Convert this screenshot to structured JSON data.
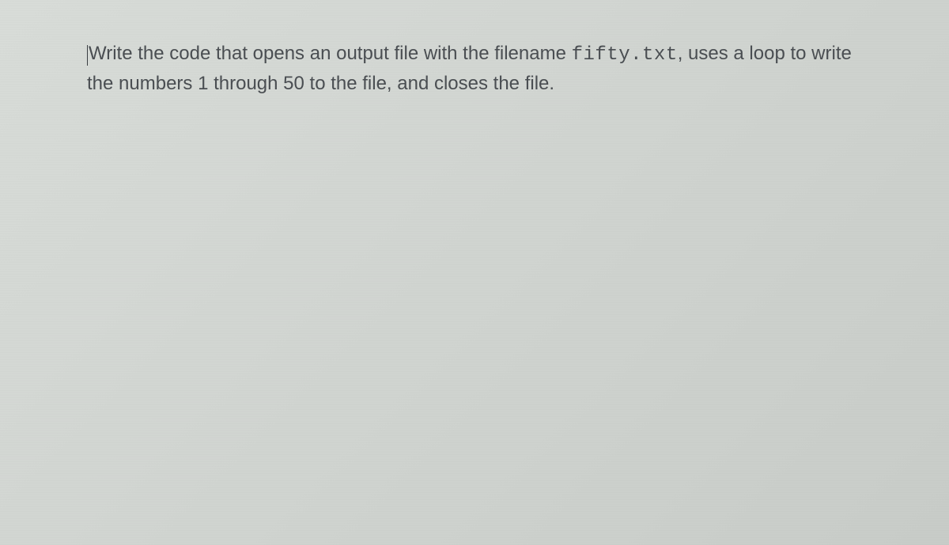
{
  "question": {
    "part1": "Write the code that opens an output file with the filename ",
    "filename": "fifty.txt",
    "part2": ", uses a loop to write the numbers 1 through 50 to the file, and closes the file."
  }
}
